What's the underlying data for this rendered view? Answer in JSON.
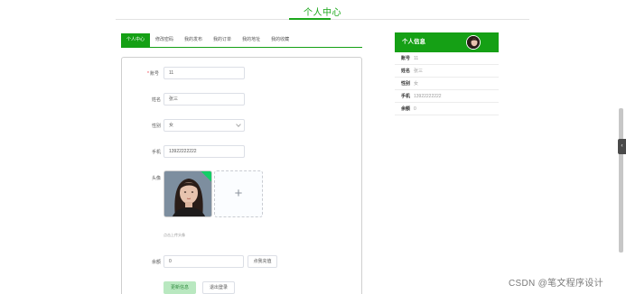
{
  "page": {
    "title": "个人中心"
  },
  "tabs": [
    "个人中心",
    "修改密码",
    "我的发布",
    "我的订单",
    "我的地址",
    "我的收藏"
  ],
  "form": {
    "account_label": "账号",
    "account_required": "*",
    "account_value": "11",
    "name_label": "姓名",
    "name_value": "张三",
    "gender_label": "性别",
    "gender_value": "女",
    "phone_label": "手机",
    "phone_value": "13922222222",
    "avatar_label": "头像",
    "avatar_hint": "点击上传头像",
    "balance_label": "余额",
    "balance_value": "0",
    "recharge_button": "点我充值",
    "update_button": "更新信息",
    "logout_button": "退出登录"
  },
  "info_panel": {
    "title": "个人信息",
    "rows": [
      {
        "key": "账号",
        "value": "11"
      },
      {
        "key": "姓名",
        "value": "张三"
      },
      {
        "key": "性别",
        "value": "女"
      },
      {
        "key": "手机",
        "value": "13922222222"
      },
      {
        "key": "余额",
        "value": "0"
      }
    ]
  },
  "watermark": "CSDN @笔文程序设计",
  "icons": {
    "plus": "+",
    "collapse": "‹"
  },
  "colors": {
    "accent": "#15a015",
    "title": "#1ca81c",
    "update_button_bg": "#b9e8c0"
  }
}
